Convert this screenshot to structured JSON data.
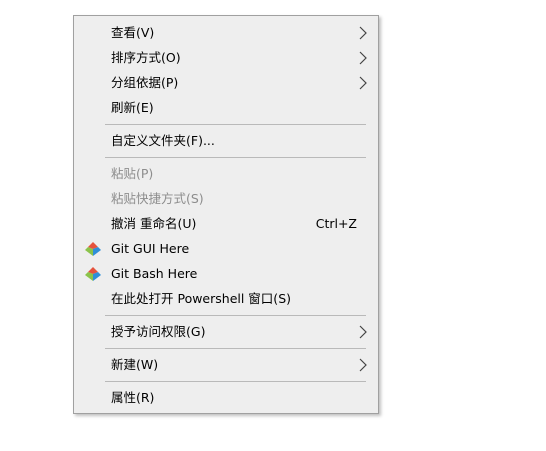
{
  "context_menu": {
    "items": [
      {
        "label": "查看(V)",
        "submenu": true
      },
      {
        "label": "排序方式(O)",
        "submenu": true
      },
      {
        "label": "分组依据(P)",
        "submenu": true
      },
      {
        "label": "刷新(E)"
      },
      {
        "label": "自定义文件夹(F)..."
      },
      {
        "label": "粘贴(P)",
        "disabled": true
      },
      {
        "label": "粘贴快捷方式(S)",
        "disabled": true
      },
      {
        "label": "撤消 重命名(U)",
        "shortcut": "Ctrl+Z"
      },
      {
        "label": "Git GUI Here",
        "icon": "git-icon"
      },
      {
        "label": "Git Bash Here",
        "icon": "git-icon"
      },
      {
        "label": "在此处打开 Powershell 窗口(S)"
      },
      {
        "label": "授予访问权限(G)",
        "submenu": true
      },
      {
        "label": "新建(W)",
        "submenu": true
      },
      {
        "label": "属性(R)"
      }
    ]
  },
  "colors": {
    "menu_bg": "#eeeeee",
    "disabled_text": "#8d8d8d",
    "separator": "#b9b9b9"
  }
}
